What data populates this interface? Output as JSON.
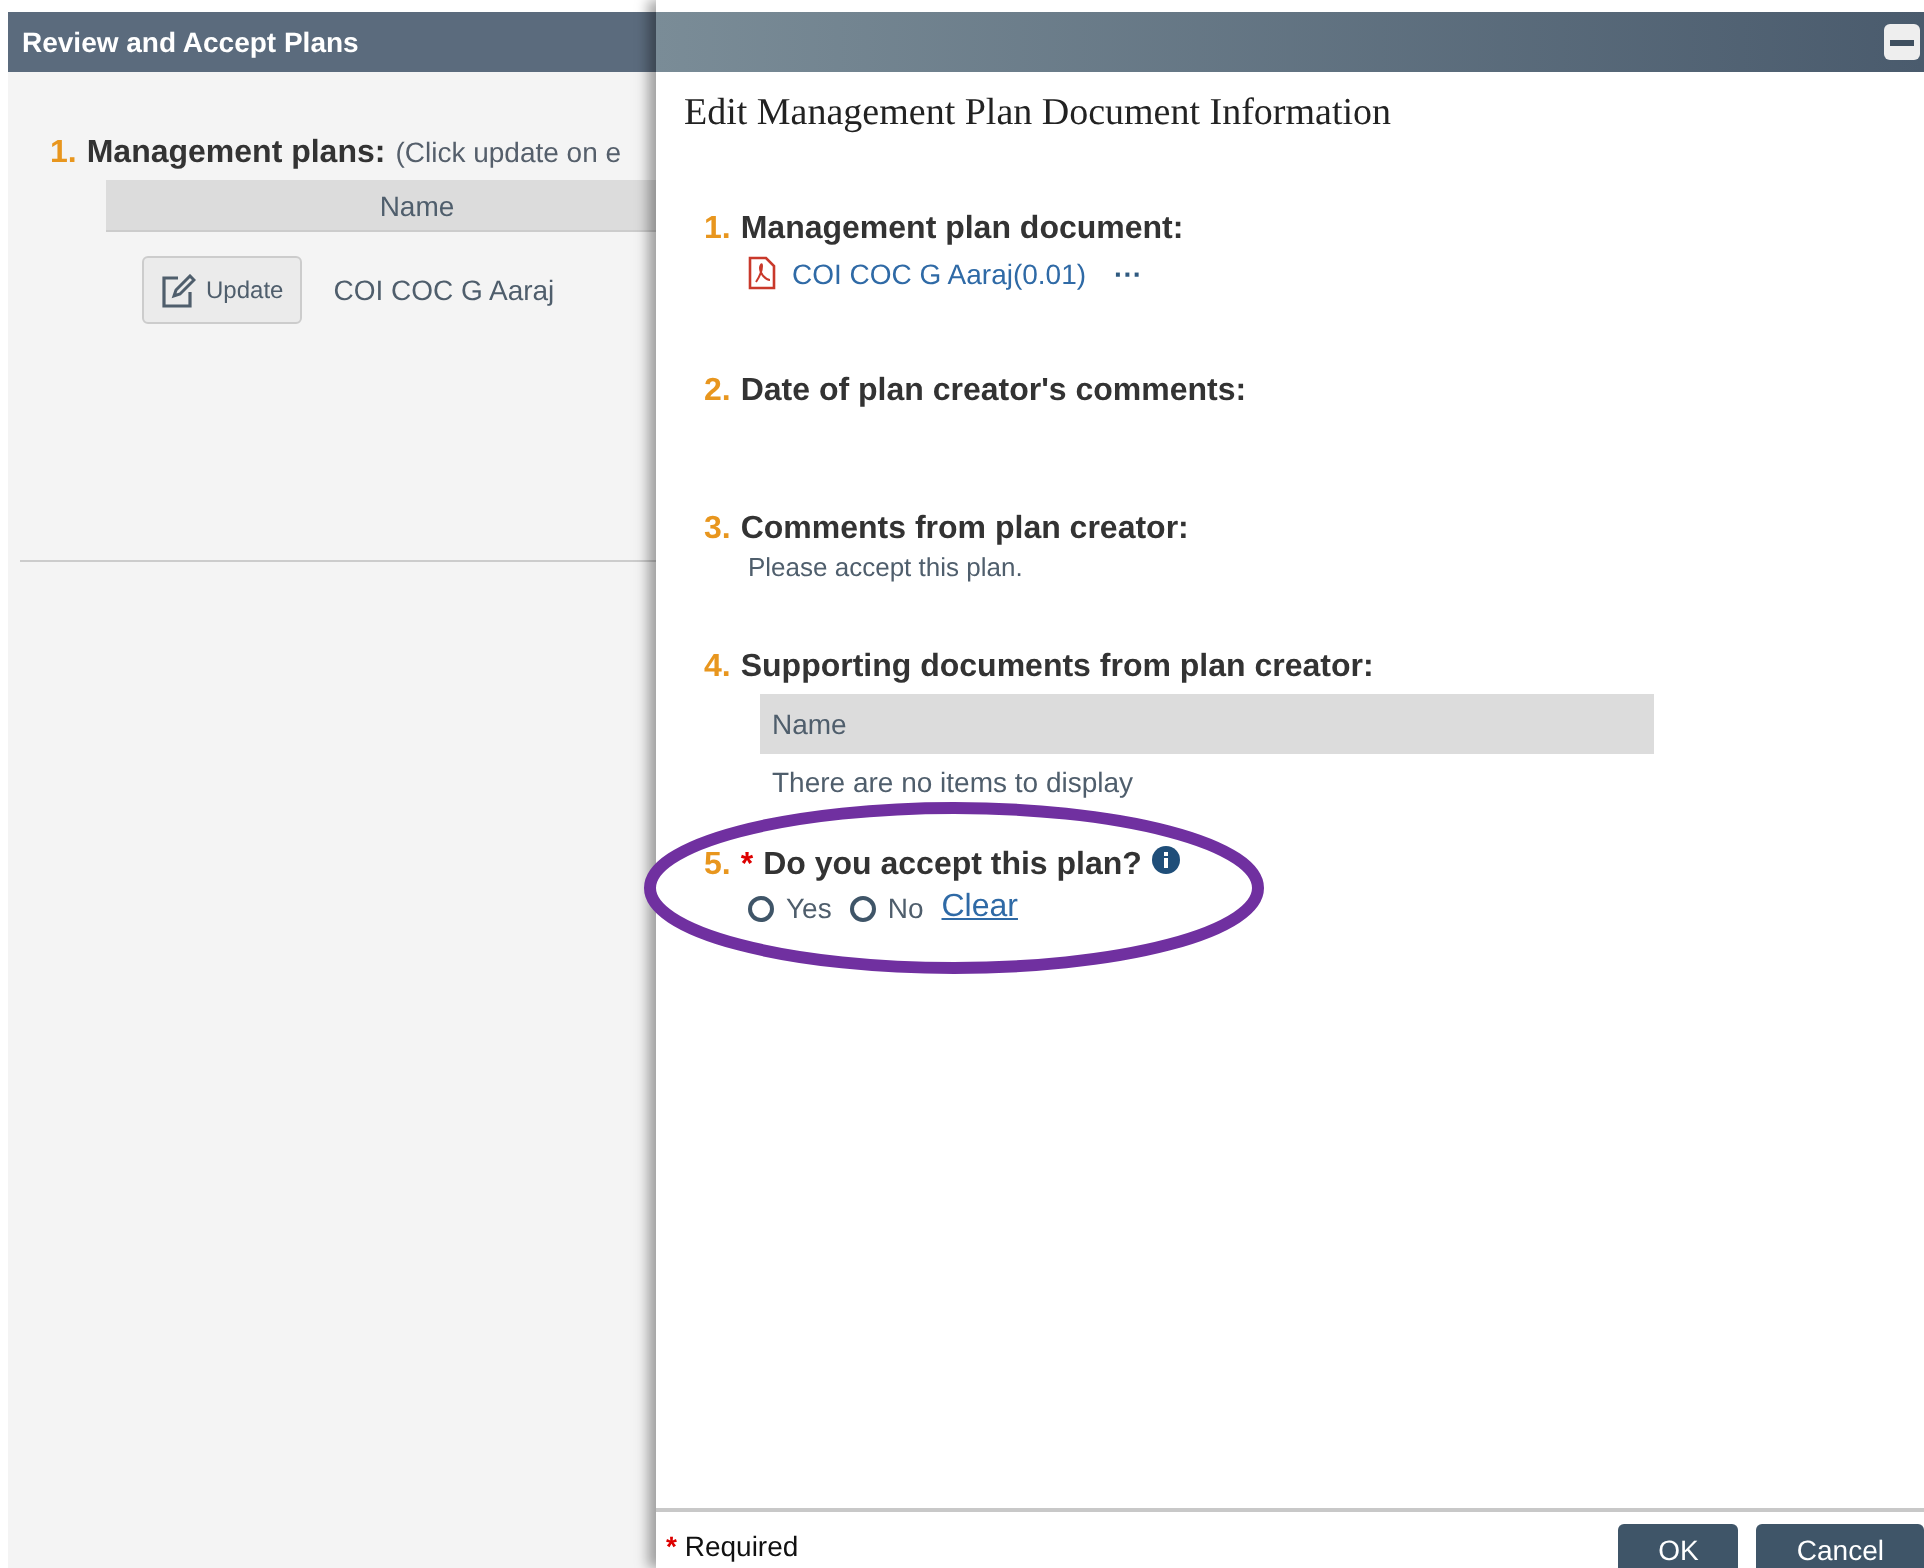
{
  "background_panel": {
    "title": "Review and Accept Plans",
    "section": {
      "number": "1.",
      "label": "Management plans:",
      "hint": "(Click update on e"
    },
    "table": {
      "columns": [
        "Name"
      ],
      "rows": [
        {
          "button": "Update",
          "name": "COI COC G Aaraj"
        }
      ]
    }
  },
  "dialog": {
    "title": "Edit Management Plan Document Information",
    "sections": [
      {
        "kind": "document",
        "number": "1.",
        "label": "Management plan document:",
        "link": "COI COC G Aaraj(0.01)",
        "more": "···"
      },
      {
        "kind": "empty",
        "number": "2.",
        "label": "Date of plan creator's comments:"
      },
      {
        "kind": "text",
        "number": "3.",
        "label": "Comments from plan creator:",
        "text": "Please accept this plan."
      },
      {
        "kind": "table",
        "number": "4.",
        "label": "Supporting documents from plan creator:",
        "columns": [
          "Name"
        ],
        "empty_text": "There are no items to display"
      },
      {
        "kind": "radio",
        "number": "5.",
        "required": true,
        "label": "Do you accept this plan?",
        "options": [
          {
            "label": "Yes",
            "selected": false
          },
          {
            "label": "No",
            "selected": false
          }
        ],
        "clear": "Clear"
      }
    ],
    "footer": {
      "required_mark": "*",
      "required_label": "Required",
      "buttons": [
        "OK",
        "Cancel"
      ]
    }
  }
}
